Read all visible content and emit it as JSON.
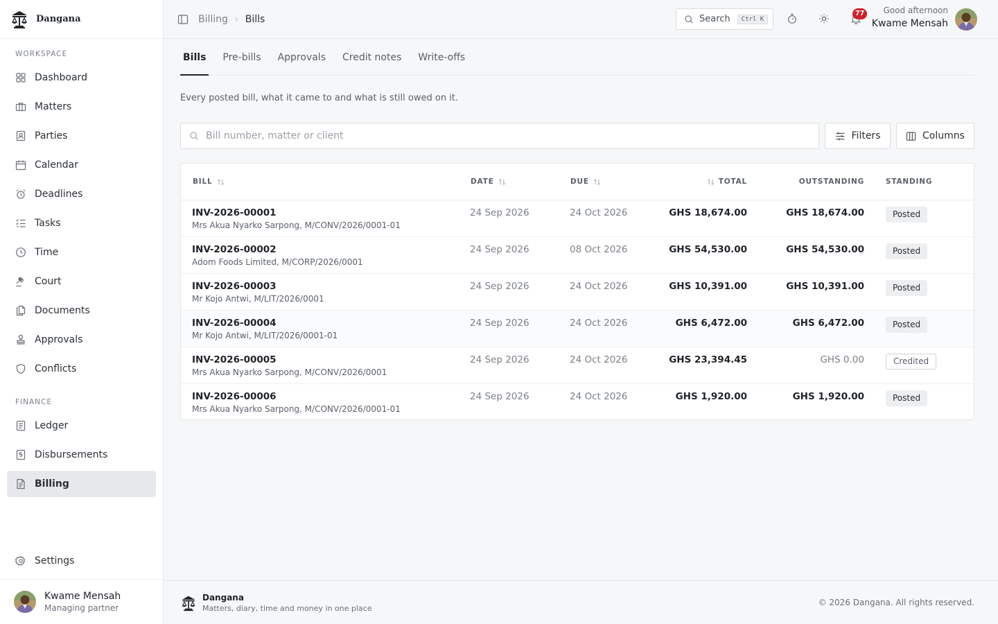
{
  "app": {
    "name": "Dangana",
    "tagline": "Matters, diary, time and money in one place",
    "copyright": "© 2026 Dangana. All rights reserved."
  },
  "sidebar": {
    "workspace_label": "WORKSPACE",
    "workspace_items": [
      {
        "label": "Dashboard",
        "icon": "dashboard-icon"
      },
      {
        "label": "Matters",
        "icon": "briefcase-icon"
      },
      {
        "label": "Parties",
        "icon": "contact-card-icon"
      },
      {
        "label": "Calendar",
        "icon": "calendar-icon"
      },
      {
        "label": "Deadlines",
        "icon": "alarm-clock-icon"
      },
      {
        "label": "Tasks",
        "icon": "task-list-icon"
      },
      {
        "label": "Time",
        "icon": "clock-icon"
      },
      {
        "label": "Court",
        "icon": "gavel-icon"
      },
      {
        "label": "Documents",
        "icon": "documents-icon"
      },
      {
        "label": "Approvals",
        "icon": "stamp-icon"
      },
      {
        "label": "Conflicts",
        "icon": "shield-icon"
      }
    ],
    "finance_label": "FINANCE",
    "finance_items": [
      {
        "label": "Ledger",
        "icon": "ledger-icon"
      },
      {
        "label": "Disbursements",
        "icon": "receipt-icon"
      },
      {
        "label": "Billing",
        "icon": "invoice-icon",
        "active": true
      }
    ],
    "settings_label": "Settings",
    "user": {
      "name": "Kwame Mensah",
      "role": "Managing partner"
    }
  },
  "topbar": {
    "breadcrumb_parent": "Billing",
    "breadcrumb_current": "Bills",
    "search_label": "Search",
    "search_shortcut": "Ctrl K",
    "notification_count": "77",
    "greeting": "Good afternoon",
    "user_name": "Kwame Mensah"
  },
  "tabs": [
    {
      "label": "Bills",
      "active": true
    },
    {
      "label": "Pre-bills"
    },
    {
      "label": "Approvals"
    },
    {
      "label": "Credit notes"
    },
    {
      "label": "Write-offs"
    }
  ],
  "page": {
    "description": "Every posted bill, what it came to and what is still owed on it.",
    "search_placeholder": "Bill number, matter or client",
    "search_value": "",
    "filters_label": "Filters",
    "columns_label": "Columns"
  },
  "table": {
    "columns": {
      "bill": "BILL",
      "date": "DATE",
      "due": "DUE",
      "total": "TOTAL",
      "outstanding": "OUTSTANDING",
      "standing": "STANDING"
    },
    "rows": [
      {
        "bill": "INV-2026-00001",
        "matter": "Mrs Akua Nyarko Sarpong, M/CONV/2026/0001-01",
        "date": "24 Sep 2026",
        "due": "24 Oct 2026",
        "total": "GHS 18,674.00",
        "outstanding": "GHS 18,674.00",
        "standing": "Posted"
      },
      {
        "bill": "INV-2026-00002",
        "matter": "Adom Foods Limited, M/CORP/2026/0001",
        "date": "24 Sep 2026",
        "due": "08 Oct 2026",
        "total": "GHS 54,530.00",
        "outstanding": "GHS 54,530.00",
        "standing": "Posted"
      },
      {
        "bill": "INV-2026-00003",
        "matter": "Mr Kojo Antwi, M/LIT/2026/0001",
        "date": "24 Sep 2026",
        "due": "24 Oct 2026",
        "total": "GHS 10,391.00",
        "outstanding": "GHS 10,391.00",
        "standing": "Posted"
      },
      {
        "bill": "INV-2026-00004",
        "matter": "Mr Kojo Antwi, M/LIT/2026/0001-01",
        "date": "24 Sep 2026",
        "due": "24 Oct 2026",
        "total": "GHS 6,472.00",
        "outstanding": "GHS 6,472.00",
        "standing": "Posted"
      },
      {
        "bill": "INV-2026-00005",
        "matter": "Mrs Akua Nyarko Sarpong, M/CONV/2026/0001",
        "date": "24 Sep 2026",
        "due": "24 Oct 2026",
        "total": "GHS 23,394.45",
        "outstanding": "GHS 0.00",
        "standing": "Credited"
      },
      {
        "bill": "INV-2026-00006",
        "matter": "Mrs Akua Nyarko Sarpong, M/CONV/2026/0001-01",
        "date": "24 Sep 2026",
        "due": "24 Oct 2026",
        "total": "GHS 1,920.00",
        "outstanding": "GHS 1,920.00",
        "standing": "Posted"
      }
    ]
  },
  "colors": {
    "accent": "#1f2328",
    "active_nav_bg": "#e6e8eb",
    "badge_red": "#cf222e",
    "page_bg": "#f6f7f8"
  }
}
